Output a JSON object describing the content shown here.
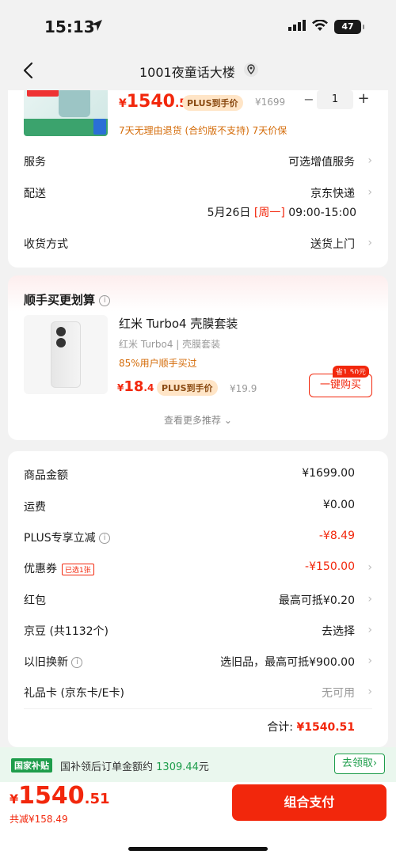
{
  "status": {
    "time": "15:13",
    "battery": "47"
  },
  "nav": {
    "title": "1001夜童话大楼"
  },
  "product": {
    "price_symbol": "¥",
    "price_int": "1540",
    "price_dec": ".51",
    "plus_tag": "PLUS到手价",
    "orig_price": "¥1699",
    "qty_minus": "−",
    "quantity": "1",
    "qty_plus": "+",
    "policy": "7天无理由退货 (合约版不支持)  7天价保"
  },
  "order_rows": {
    "service": {
      "label": "服务",
      "value": "可选增值服务"
    },
    "delivery": {
      "label": "配送",
      "value": "京东快递",
      "date": "5月26日",
      "weekday": "[周一]",
      "time": "09:00-15:00"
    },
    "receive": {
      "label": "收货方式",
      "value": "送货上门"
    }
  },
  "recommend": {
    "title": "顺手买更划算",
    "item_name": "红米 Turbo4 壳膜套装",
    "item_sub": "红米 Turbo4 | 壳膜套装",
    "item_stat": "85%用户顺手买过",
    "price_symbol": "¥",
    "price_int": "18",
    "price_dec": ".4",
    "plus_tag": "PLUS到手价",
    "orig_price": "¥19.9",
    "save_tag": "省1.50元",
    "buy_label": "一键购买",
    "more_label": "查看更多推荐"
  },
  "summary": {
    "goods": {
      "label": "商品金额",
      "value": "¥1699.00"
    },
    "shipping": {
      "label": "运费",
      "value": "¥0.00"
    },
    "plus_discount": {
      "label": "PLUS专享立减",
      "value": "-¥8.49"
    },
    "coupon": {
      "label": "优惠券",
      "tag": "已选1张",
      "value": "-¥150.00"
    },
    "red_packet": {
      "label": "红包",
      "value": "最高可抵¥0.20"
    },
    "jd_beans": {
      "label": "京豆 (共1132个)",
      "value": "去选择"
    },
    "trade_in": {
      "label": "以旧换新",
      "value": "选旧品，最高可抵¥900.00"
    },
    "gift_card": {
      "label": "礼品卡 (京东卡/E卡)",
      "value": "无可用"
    },
    "total_label": "合计:",
    "total_value": "¥1540.51"
  },
  "subsidy": {
    "badge": "国家补贴",
    "text_prefix": "国补领后订单金额约",
    "amount": "1309.44",
    "unit": "元",
    "button": "去领取"
  },
  "bottom": {
    "price_symbol": "¥",
    "price_int": "1540",
    "price_dec": ".51",
    "saved": "共减¥158.49",
    "pay_button": "组合支付"
  },
  "colors": {
    "accent": "#f2270c",
    "subsidy_green": "#1e9d4b",
    "plus_bg": "#ffe5c7"
  }
}
